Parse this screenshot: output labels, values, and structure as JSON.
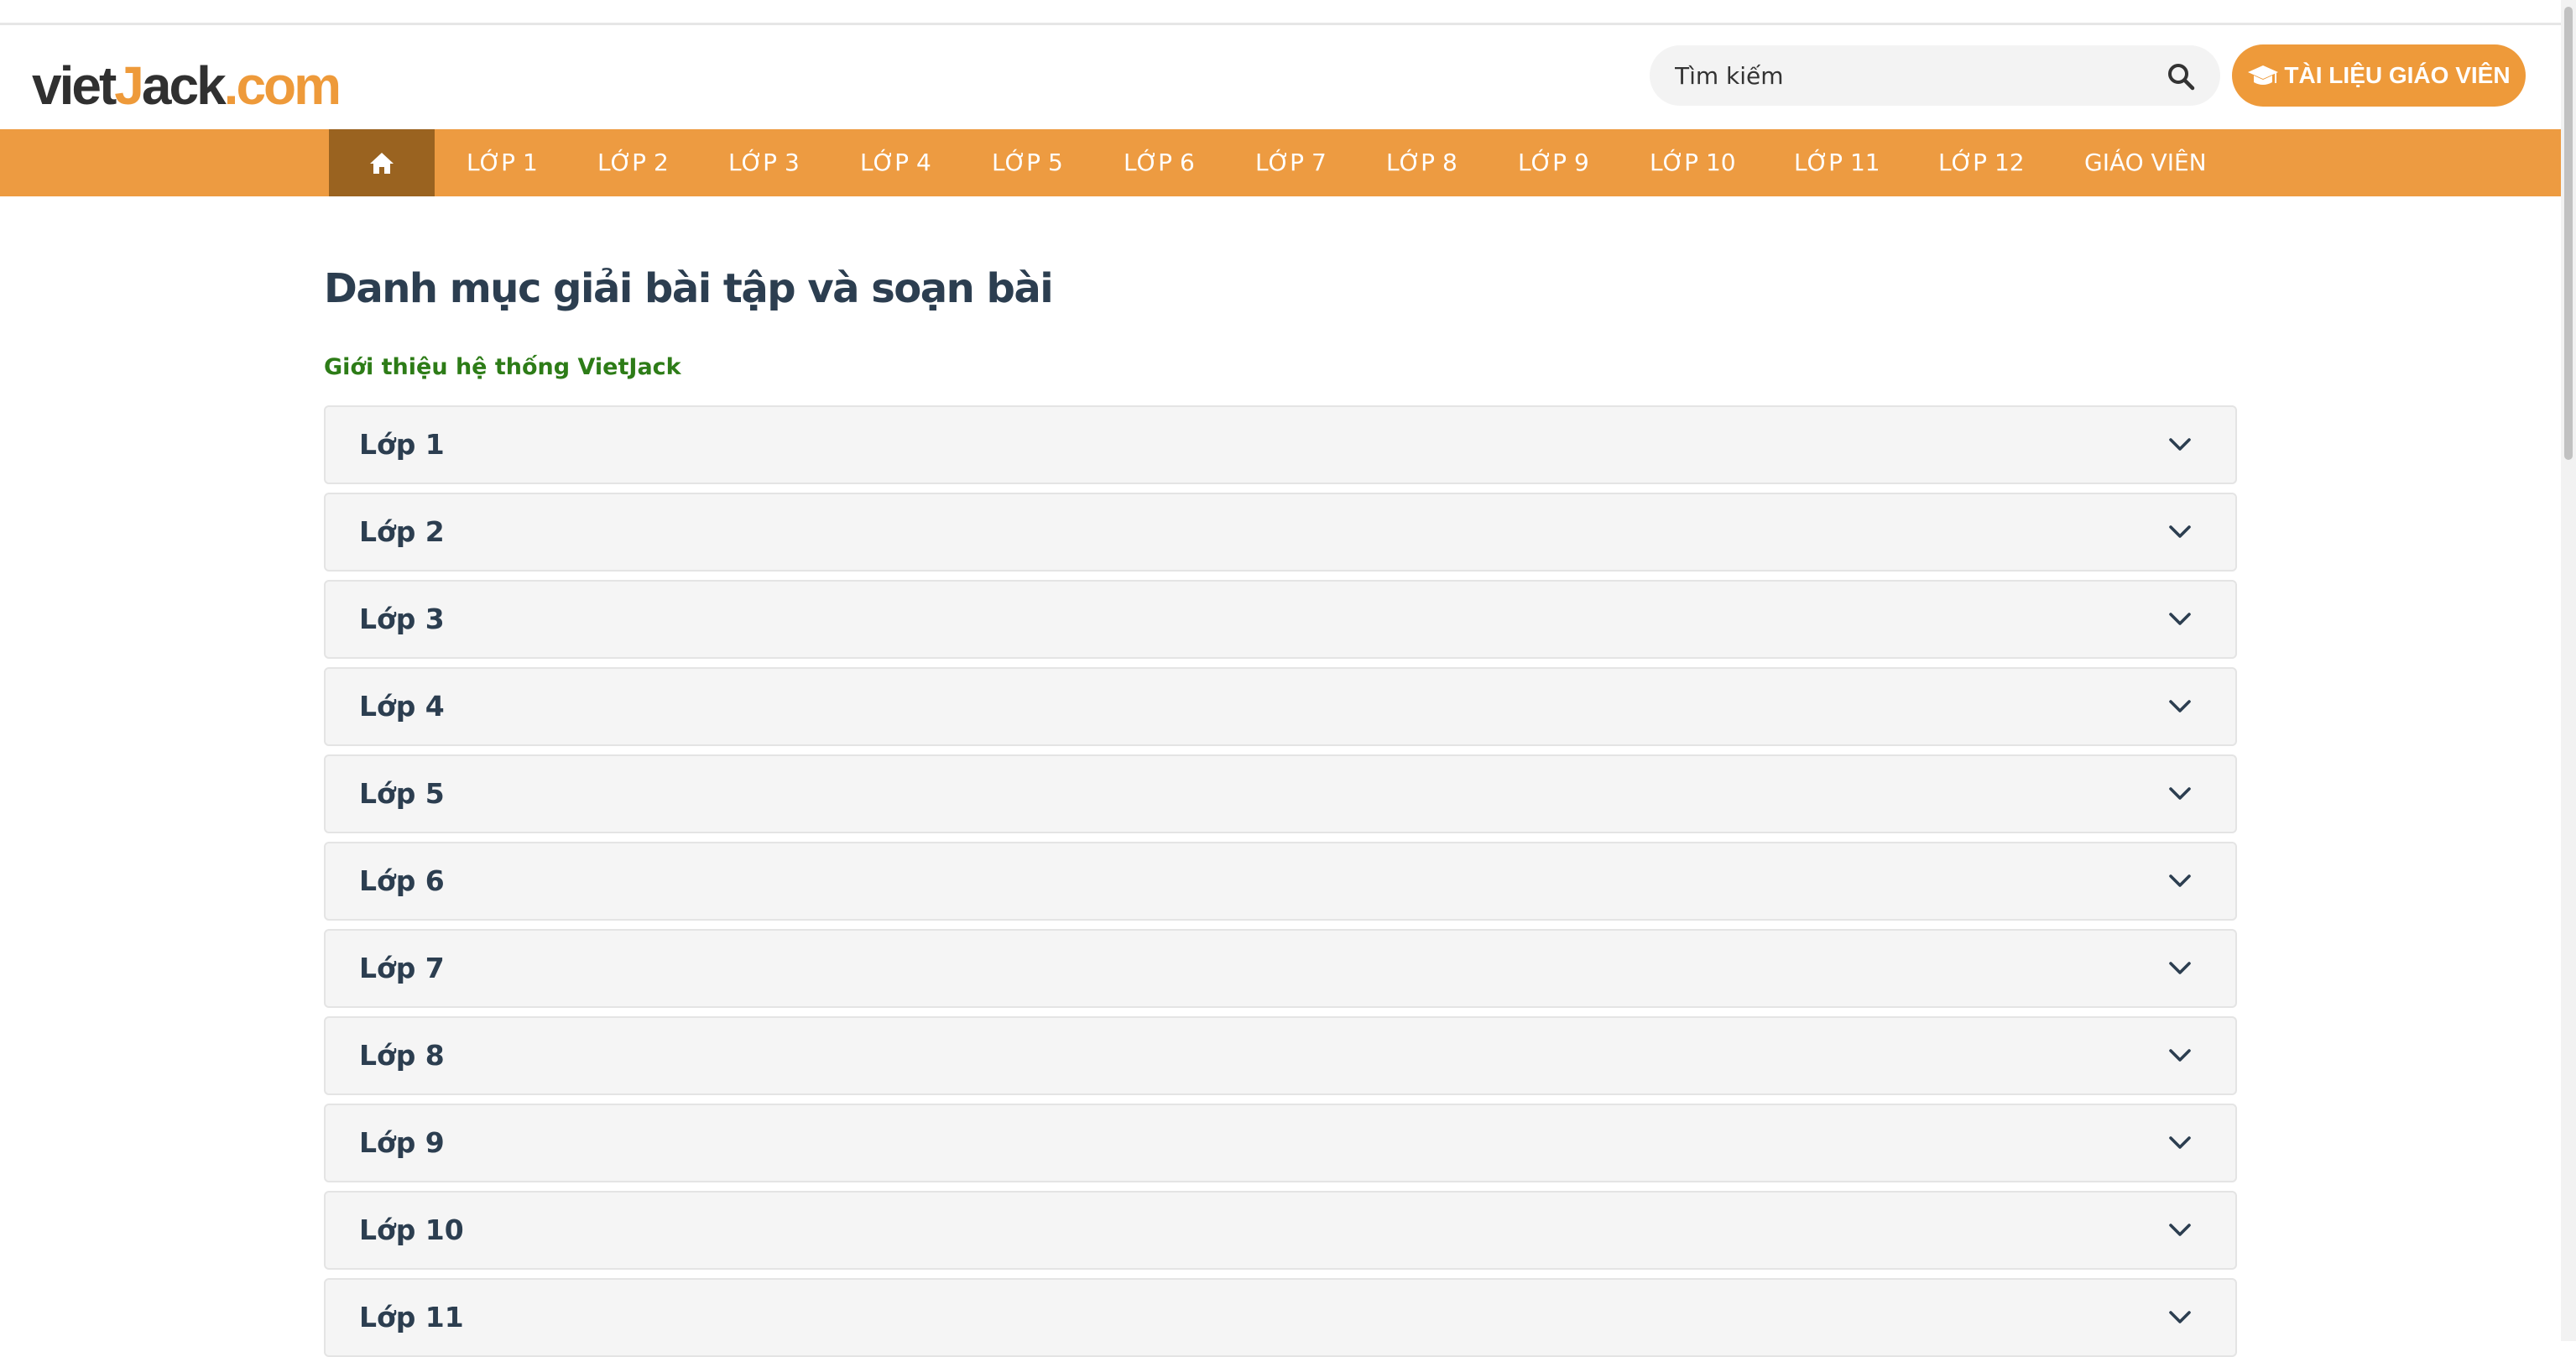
{
  "header": {
    "logo": {
      "part1": "viet",
      "part2": "J",
      "part3": "ack",
      "part4": ".com"
    },
    "search": {
      "placeholder": "Tìm kiếm",
      "icon": "search-icon"
    },
    "teacher_button": {
      "label": "TÀI LIỆU GIÁO VIÊN",
      "icon": "graduation-cap-icon"
    }
  },
  "nav": {
    "home_icon": "home-icon",
    "items": [
      {
        "label": "LỚP 1"
      },
      {
        "label": "LỚP 2"
      },
      {
        "label": "LỚP 3"
      },
      {
        "label": "LỚP 4"
      },
      {
        "label": "LỚP 5"
      },
      {
        "label": "LỚP 6"
      },
      {
        "label": "LỚP 7"
      },
      {
        "label": "LỚP 8"
      },
      {
        "label": "LỚP 9"
      },
      {
        "label": "LỚP 10"
      },
      {
        "label": "LỚP 11"
      },
      {
        "label": "LỚP 12"
      },
      {
        "label": "GIÁO VIÊN"
      }
    ]
  },
  "main": {
    "title": "Danh mục giải bài tập và soạn bài",
    "intro_link": "Giới thiệu hệ thống VietJack",
    "accordion": [
      {
        "label": "Lớp 1"
      },
      {
        "label": "Lớp 2"
      },
      {
        "label": "Lớp 3"
      },
      {
        "label": "Lớp 4"
      },
      {
        "label": "Lớp 5"
      },
      {
        "label": "Lớp 6"
      },
      {
        "label": "Lớp 7"
      },
      {
        "label": "Lớp 8"
      },
      {
        "label": "Lớp 9"
      },
      {
        "label": "Lớp 10"
      },
      {
        "label": "Lớp 11"
      }
    ]
  },
  "colors": {
    "brand_orange": "#ee9a3a",
    "nav_orange": "#ed9b41",
    "nav_home_active": "#9a6320",
    "title_text": "#2c3e50",
    "link_green": "#2d7c17"
  }
}
